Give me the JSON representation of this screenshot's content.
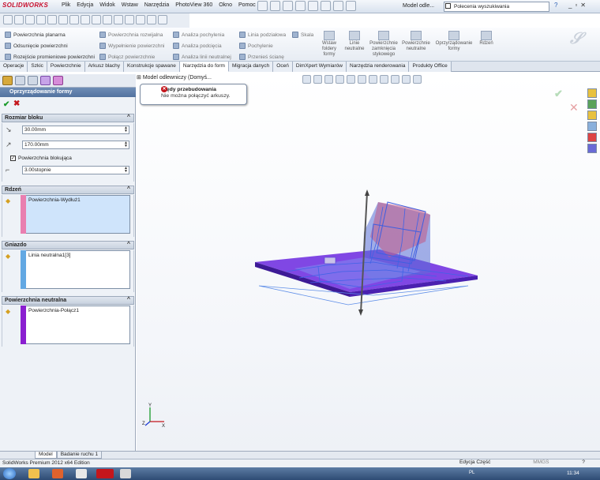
{
  "app": {
    "logo": "SOLIDWORKS",
    "menus": [
      "Plik",
      "Edycja",
      "Widok",
      "Wstaw",
      "Narzędzia",
      "PhotoView 360",
      "Okno",
      "Pomoc"
    ],
    "doc_title": "Model odle...",
    "search_placeholder": "Polecenia wyszukiwania",
    "help": "?",
    "window_controls": [
      "_",
      "▫",
      "✕"
    ]
  },
  "command_manager": {
    "col1": [
      "Powierzchnia planarna",
      "Odsunięcie powierzchni",
      "Rozejście promieniowe powierzchni"
    ],
    "col2": [
      "Powierzchnia rozwijalna",
      "Wypełnienie powierzchni",
      "Połącz powierzchnie"
    ],
    "col3": [
      "Analiza pochylenia",
      "Analiza podcięcia",
      "Analiza linii neutralnej"
    ],
    "col4": [
      "Linia podziałowa",
      "Pochylenie",
      "Przenieś ścianę"
    ],
    "col5": [
      "Skala"
    ],
    "big_buttons": [
      "Wstaw foldery formy",
      "Linie neutralne",
      "Powierzchnie zamknięcia stykowego",
      "Powierzchnie neutralne",
      "Oprzyrządowanie formy",
      "Rdzeń"
    ]
  },
  "tabs": [
    "Operacje",
    "Szkic",
    "Powierzchnie",
    "Arkusz blachy",
    "Konstrukcje spawane",
    "Narzędzia do form",
    "Migracja danych",
    "Oceń",
    "DimXpert Wymiarów",
    "Narzędzia renderowania",
    "Produkty Office"
  ],
  "active_tab": "Narzędzia do form",
  "property_manager": {
    "title": "Oprzyrządowanie formy",
    "ok": "✔",
    "cancel": "✖",
    "block_size": {
      "header": "Rozmiar bloku",
      "field1": "30.00mm",
      "field2": "170.00mm",
      "checkbox_label": "Powierzchnia blokująca",
      "checkbox_checked": true,
      "field3": "3.00stopnie"
    },
    "core": {
      "header": "Rdzeń",
      "item": "Powierzchnia-Wydłuż1",
      "color": "#e97fb0"
    },
    "cavity": {
      "header": "Gniazdo",
      "item": "Linia neutralna1[3]",
      "color": "#62a8e3"
    },
    "parting": {
      "header": "Powierzchnia neutralna",
      "item": "Powierzchnia-Połącz1",
      "color": "#8a1fd0"
    }
  },
  "graphics": {
    "tree_label": "Model odlewniczy  (Domyś...",
    "tooltip_title": "Błędy przebudowania",
    "tooltip_msg": "Nie można połączyć arkuszy."
  },
  "bottom_tabs": [
    "Model",
    "Badanie ruchu 1"
  ],
  "status": {
    "left": "SolidWorks Premium 2012 x64 Edition",
    "right": "Edycja Część",
    "mmgs": "MMGS",
    "help": "?"
  },
  "taskbar": {
    "lang": "PL",
    "time": "11:34"
  }
}
